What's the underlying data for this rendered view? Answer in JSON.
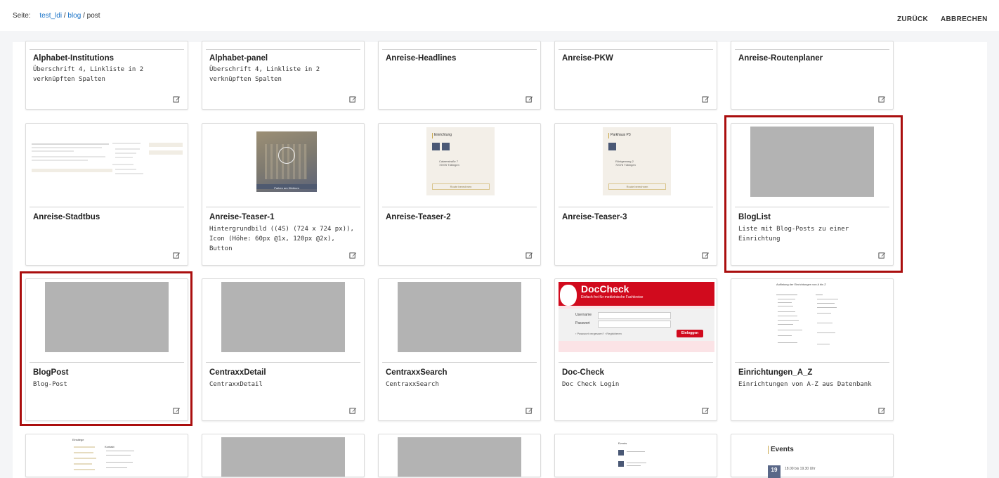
{
  "breadcrumb": {
    "label": "Seite:",
    "items": [
      "test_ldi",
      "blog",
      "post"
    ],
    "separator": "/"
  },
  "actions": {
    "back": "ZURÜCK",
    "cancel": "ABBRECHEN"
  },
  "cards": [
    {
      "title": "Alphabet-Institutions",
      "desc": "Überschrift 4, Linkliste in 2 verknüpften Spalten"
    },
    {
      "title": "Alphabet-panel",
      "desc": "Überschrift 4, Linkliste in 2 verknüpften Spalten"
    },
    {
      "title": "Anreise-Headlines",
      "desc": ""
    },
    {
      "title": "Anreise-PKW",
      "desc": ""
    },
    {
      "title": "Anreise-Routenplaner",
      "desc": ""
    },
    {
      "title": "Anreise-Stadtbus",
      "desc": ""
    },
    {
      "title": "Anreise-Teaser-1",
      "desc": "Hintergrundbild ((4S) (724 x 724 px)), Icon (Höhe: 60px @1x, 120px @2x), Button"
    },
    {
      "title": "Anreise-Teaser-2",
      "desc": ""
    },
    {
      "title": "Anreise-Teaser-3",
      "desc": ""
    },
    {
      "title": "BlogList",
      "desc": "Liste mit Blog-Posts zu einer Einrichtung"
    },
    {
      "title": "BlogPost",
      "desc": "Blog-Post"
    },
    {
      "title": "CentraxxDetail",
      "desc": "CentraxxDetail"
    },
    {
      "title": "CentraxxSearch",
      "desc": "CentraxxSearch"
    },
    {
      "title": "Doc-Check",
      "desc": "Doc Check Login"
    },
    {
      "title": "Einrichtungen_A_Z",
      "desc": "Einrichtungen von A-Z aus Datenbank"
    }
  ],
  "thumb_text": {
    "einrichtung": "Einrichtung",
    "parkhaus": "Parkhaus P3",
    "addr2": "Calwerstraße 7\n72076 Tübingen",
    "addr3": "Röntgenweg 2\n72076 Tübingen",
    "btn": "Route berechnen",
    "doccheck_logo": "DocCheck",
    "doccheck_tag": "Einfach frei für medizinische Fachkreise",
    "username": "Username",
    "password": "Passwort",
    "login": "Einloggen",
    "forgot": "Passwort vergessen?",
    "register": "Registrieren",
    "teaser_btn": "Parken am Klinikum",
    "az_title": "Auflistung der Einrichtungen von A bis Z",
    "events": "Events",
    "event_day": "19",
    "event_time": "18.00 bis 19.30 Uhr",
    "einstiege": "Einstiege",
    "kontakt": "Kontakt",
    "news": "Events"
  },
  "icons": {
    "edit": "edit-icon"
  },
  "colors": {
    "highlight": "#aa0e0e",
    "link": "#1a73c8",
    "placeholder": "#b3b3b3",
    "doccheck_red": "#d10a1d"
  }
}
